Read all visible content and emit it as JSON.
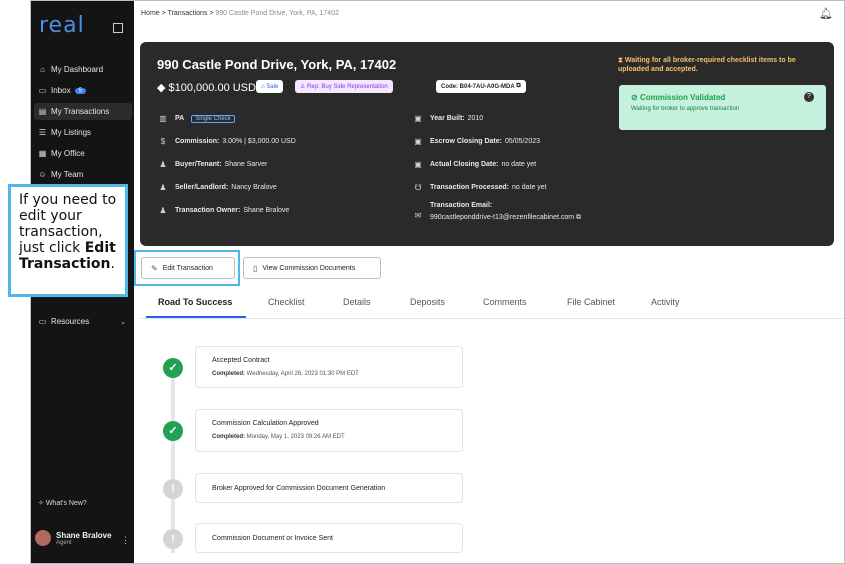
{
  "sidebar": {
    "logo": "real",
    "items": [
      {
        "label": "My Dashboard",
        "icon": "home-icon"
      },
      {
        "label": "Inbox",
        "icon": "inbox-icon",
        "badge": "5"
      },
      {
        "label": "My Transactions",
        "icon": "transactions-icon"
      },
      {
        "label": "My Listings",
        "icon": "list-icon"
      },
      {
        "label": "My Office",
        "icon": "office-icon"
      },
      {
        "label": "My Team",
        "icon": "team-icon"
      },
      {
        "label": "Resources",
        "icon": "resources-icon"
      }
    ],
    "whats_new": "What's New?",
    "user": {
      "name": "Shane Bralove",
      "role": "Agent"
    }
  },
  "breadcrumb": {
    "home": "Home",
    "sep1": ">",
    "transactions": "Transactions",
    "sep2": ">",
    "current": "990 Castle Pond Drive, York, PA, 17402"
  },
  "transaction": {
    "address": "990 Castle Pond Drive, York, PA, 17402",
    "price": "$100,000.00 USD",
    "sale_chip": "Sale",
    "rep_chip": "Rep: Buy Side Representation",
    "code_chip": "Code: B04-7AU-A0G-MDA",
    "state": "PA",
    "single_check": "Single Check",
    "commission_label": "Commission:",
    "commission_value": "3.00% | $3,000.00 USD",
    "buyer_label": "Buyer/Tenant:",
    "buyer_value": "Shane Sarver",
    "seller_label": "Seller/Landlord:",
    "seller_value": "Nancy Bralove",
    "owner_label": "Transaction Owner:",
    "owner_value": "Shane Bralove",
    "year_label": "Year Built:",
    "year_value": "2010",
    "escrow_label": "Escrow Closing Date:",
    "escrow_value": "05/05/2023",
    "actual_label": "Actual Closing Date:",
    "actual_value": "no date yet",
    "processed_label": "Transaction Processed:",
    "processed_value": "no date yet",
    "email_label": "Transaction Email:",
    "email_value": "990castleponddrive-t13@rezenfilecabinet.com",
    "waiting": "Waiting for all broker-required checklist items to be uploaded and accepted.",
    "validated_title": "Commission Validated",
    "validated_sub": "Waiting for broker to approve transaction"
  },
  "actions": {
    "edit": "Edit Transaction",
    "docs": "View Commission Documents"
  },
  "tabs": [
    "Road To Success",
    "Checklist",
    "Details",
    "Deposits",
    "Comments",
    "File Cabinet",
    "Activity"
  ],
  "steps": [
    {
      "title": "Accepted Contract",
      "sub_label": "Completed:",
      "sub_value": "Wednesday, April 26, 2023 01:30 PM EDT",
      "status": "done"
    },
    {
      "title": "Commission Calculation Approved",
      "sub_label": "Completed:",
      "sub_value": "Monday, May 1, 2023 09:26 AM EDT",
      "status": "done"
    },
    {
      "title": "Broker Approved for Commission Document Generation",
      "status": "pending"
    },
    {
      "title": "Commission Document or Invoice Sent",
      "status": "pending"
    }
  ],
  "callout": {
    "text": "If you need to edit your transaction, just click ",
    "bold": "Edit Transaction",
    "end": "."
  },
  "colors": {
    "accent": "#2563eb",
    "success": "#22a154",
    "highlight": "#4fb8e8",
    "card": "#2a2a2a"
  }
}
